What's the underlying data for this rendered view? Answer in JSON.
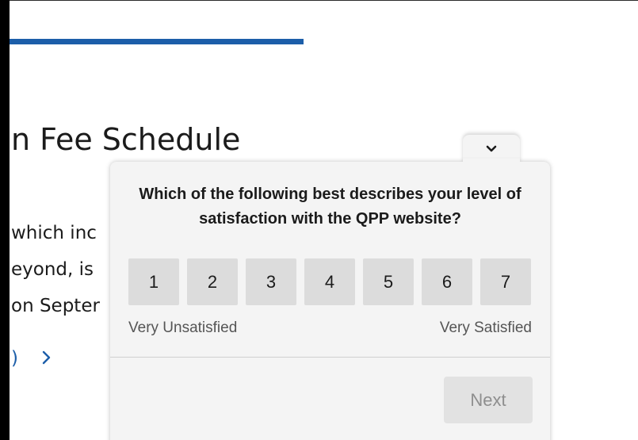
{
  "background": {
    "heading": "n Fee Schedule",
    "lines": [
      "which inc",
      "eyond, is",
      "on Septer"
    ],
    "link_fragment": ")",
    "link_chevron_icon": "chevron-right-icon",
    "accent_color": "#1c5ea9"
  },
  "survey": {
    "collapse_icon": "chevron-down-icon",
    "question": "Which of the following best describes your level of satisfaction with the QPP website?",
    "scale": [
      "1",
      "2",
      "3",
      "4",
      "5",
      "6",
      "7"
    ],
    "low_label": "Very Unsatisfied",
    "high_label": "Very Satisfied",
    "next_label": "Next"
  }
}
